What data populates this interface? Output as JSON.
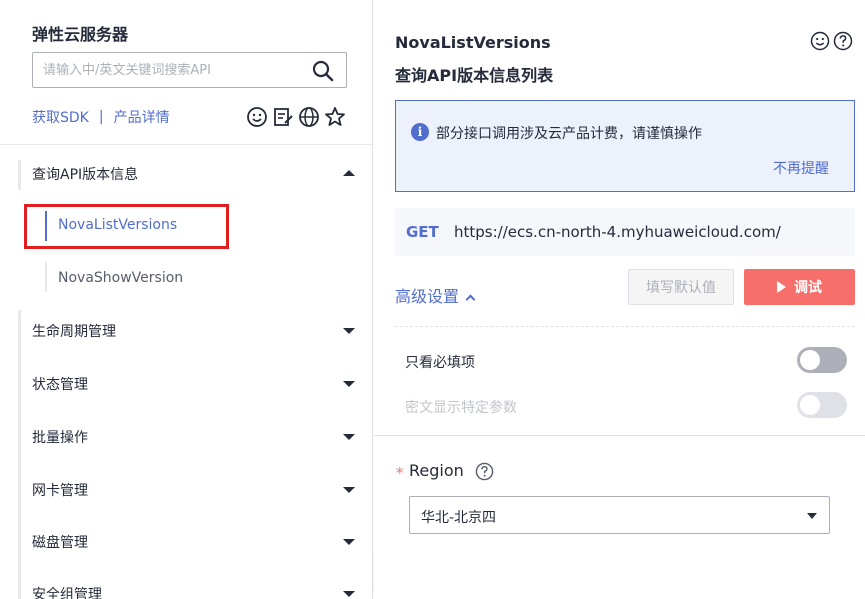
{
  "sidebar": {
    "title": "弹性云服务器",
    "search_placeholder": "请输入中/英文关键词搜索API",
    "links": {
      "sdk": "获取SDK",
      "separator": "|",
      "product": "产品详情"
    },
    "icons": [
      "smile-icon",
      "feedback-icon",
      "globe-icon",
      "star-icon"
    ],
    "groups": [
      {
        "label": "查询API版本信息",
        "expanded": true,
        "children": [
          {
            "label": "NovaListVersions",
            "active": true
          },
          {
            "label": "NovaShowVersion",
            "active": false
          }
        ]
      },
      {
        "label": "生命周期管理",
        "expanded": false
      },
      {
        "label": "状态管理",
        "expanded": false
      },
      {
        "label": "批量操作",
        "expanded": false
      },
      {
        "label": "网卡管理",
        "expanded": false
      },
      {
        "label": "磁盘管理",
        "expanded": false
      },
      {
        "label": "安全组管理",
        "expanded": false
      }
    ]
  },
  "main": {
    "api_name": "NovaListVersions",
    "api_desc": "查询API版本信息列表",
    "top_icons": [
      "smile-icon",
      "help-icon"
    ],
    "notice": {
      "text": "部分接口调用涉及云产品计费，请谨慎操作",
      "dismiss": "不再提醒"
    },
    "request": {
      "method": "GET",
      "url": "https://ecs.cn-north-4.myhuaweicloud.com/"
    },
    "advanced_label": "高级设置",
    "buttons": {
      "fill_default": "填写默认值",
      "debug": "调试"
    },
    "options": [
      {
        "label": "只看必填项",
        "enabled": true,
        "on": false
      },
      {
        "label": "密文显示特定参数",
        "enabled": false,
        "on": false
      }
    ],
    "region": {
      "required_mark": "*",
      "label": "Region",
      "value": "华北-北京四"
    }
  },
  "colors": {
    "accent": "#526ecc",
    "danger": "#f66f6a",
    "highlight": "#e02020"
  }
}
